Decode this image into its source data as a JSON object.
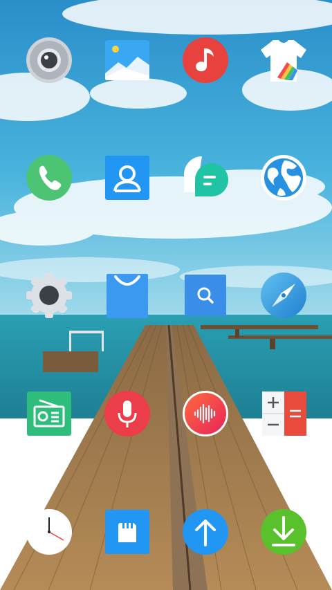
{
  "screen": {
    "type": "android-home-screen",
    "wallpaper": "wooden-pier-over-sea-under-cloudy-sky"
  },
  "apps": [
    {
      "icon": "camera-icon"
    },
    {
      "icon": "gallery-icon"
    },
    {
      "icon": "music-icon"
    },
    {
      "icon": "themes-icon"
    },
    {
      "icon": "phone-icon"
    },
    {
      "icon": "contacts-icon"
    },
    {
      "icon": "messages-icon"
    },
    {
      "icon": "browser-icon"
    },
    {
      "icon": "settings-icon"
    },
    {
      "icon": "app-store-icon"
    },
    {
      "icon": "search-icon"
    },
    {
      "icon": "compass-icon"
    },
    {
      "icon": "fm-radio-icon"
    },
    {
      "icon": "voice-recorder-icon"
    },
    {
      "icon": "sound-recognition-icon"
    },
    {
      "icon": "calculator-icon"
    },
    {
      "icon": "clock-icon"
    },
    {
      "icon": "sd-card-icon"
    },
    {
      "icon": "upload-icon"
    },
    {
      "icon": "download-icon"
    }
  ],
  "colors": {
    "sky": "#2f9bd0",
    "sea": "#2aa4b5",
    "pier": "#a07a4d",
    "music": "#e8423e",
    "phone": "#4cc474",
    "blue": "#2196f3",
    "messages": "#20c4a4",
    "recorder": "#ec3d4a",
    "radio": "#2ebd7b",
    "download": "#59c12c"
  }
}
